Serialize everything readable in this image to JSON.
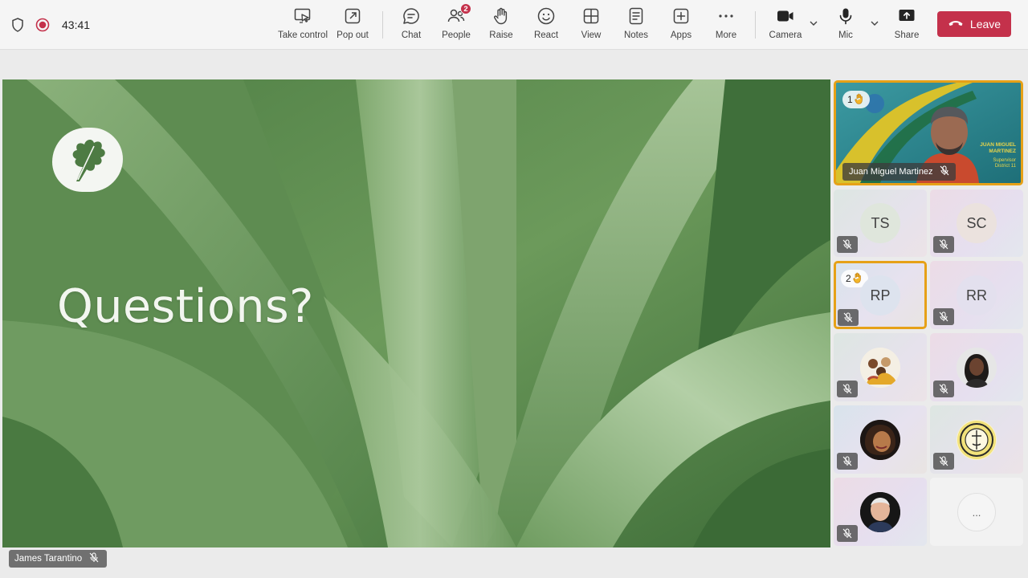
{
  "meeting": {
    "elapsed": "43:41"
  },
  "toolbar": {
    "take_control": "Take control",
    "pop_out": "Pop out",
    "chat": "Chat",
    "people": "People",
    "people_badge": "2",
    "raise": "Raise",
    "react": "React",
    "view": "View",
    "notes": "Notes",
    "apps": "Apps",
    "more": "More",
    "camera": "Camera",
    "mic": "Mic",
    "share": "Share",
    "leave": "Leave"
  },
  "slide": {
    "title": "Questions?"
  },
  "presenter": {
    "name": "James Tarantino"
  },
  "participants": {
    "featured": {
      "name": "Juan Miguel Martinez",
      "hand_position": "1",
      "banner_name": "JUAN MIGUEL MARTINEZ",
      "banner_role": "Supervisor District 11"
    },
    "tiles": [
      {
        "initials": "TS"
      },
      {
        "initials": "SC"
      },
      {
        "initials": "RP",
        "hand_position": "2"
      },
      {
        "initials": "RR"
      }
    ],
    "overflow_label": "..."
  },
  "colors": {
    "leave": "#c4314b",
    "highlight": "#e6a117",
    "badge": "#c4314b"
  }
}
